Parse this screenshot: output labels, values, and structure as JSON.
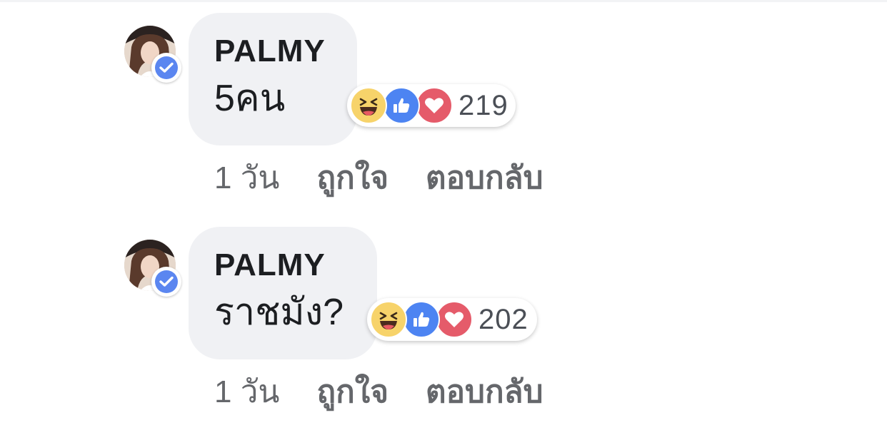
{
  "comments": [
    {
      "author": "PALMY",
      "text": "5คน",
      "reaction_count": "219",
      "time": "1 วัน",
      "like_label": "ถูกใจ",
      "reply_label": "ตอบกลับ"
    },
    {
      "author": "PALMY",
      "text": "ราชมัง?",
      "reaction_count": "202",
      "time": "1 วัน",
      "like_label": "ถูกใจ",
      "reply_label": "ตอบกลับ"
    }
  ],
  "reaction_icons": [
    "haha-icon",
    "like-icon",
    "love-icon"
  ],
  "colors": {
    "bubble": "#f0f1f4",
    "verified": "#5b86f0",
    "like": "#4d84f2",
    "love": "#e55b6a",
    "haha": "#f7d36a",
    "meta_text": "#65676b"
  }
}
